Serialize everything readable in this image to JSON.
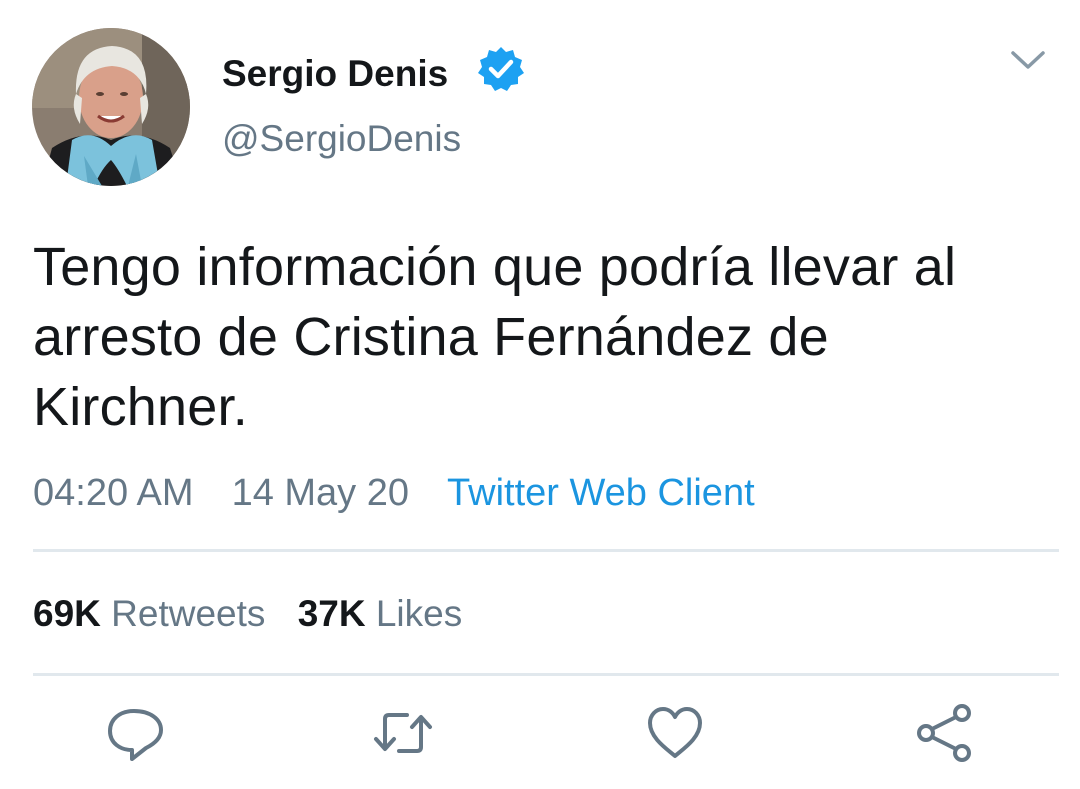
{
  "colors": {
    "text": "#14171a",
    "secondary": "#657786",
    "link": "#1b95e0",
    "verified": "#1da1f2",
    "divider": "#e1e8ed"
  },
  "user": {
    "display_name": "Sergio Denis",
    "handle": "@SergioDenis",
    "verified_icon": "verified-badge-icon",
    "menu_icon": "chevron-down-icon"
  },
  "tweet": {
    "text": "Tengo información que podría llevar al arresto de Cristina Fernández de Kirchner.",
    "time": "04:20 AM",
    "date": "14 May 20",
    "source": "Twitter Web Client"
  },
  "stats": {
    "retweets_count": "69K",
    "retweets_label": "Retweets",
    "likes_count": "37K",
    "likes_label": "Likes"
  },
  "actions": [
    {
      "icon": "reply-icon"
    },
    {
      "icon": "retweet-icon"
    },
    {
      "icon": "like-heart-icon"
    },
    {
      "icon": "share-icon"
    }
  ]
}
